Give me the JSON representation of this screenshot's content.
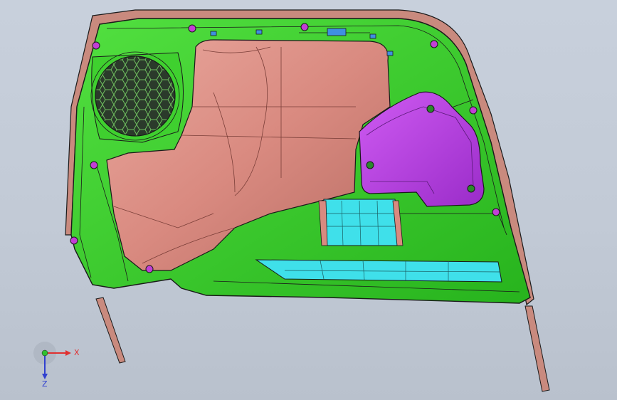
{
  "viewport": {
    "background_top": "#c8d0dc",
    "background_bottom": "#b9c1cd"
  },
  "colors": {
    "trim_border": "#c98a7e",
    "carrier_panel": "#35d12a",
    "upholstery_insert": "#d98a80",
    "pull_handle_cover": "#b33fe0",
    "map_pocket": "#3fe0ea",
    "speaker_grille": "#2b3a2b",
    "clip_mount": "#c23fd6",
    "outline": "#1a1a1a"
  },
  "model": {
    "components": [
      {
        "id": "trim-border",
        "icon": "outer-trim-strip-icon"
      },
      {
        "id": "carrier-panel",
        "icon": "door-carrier-icon"
      },
      {
        "id": "speaker-grille",
        "icon": "speaker-grille-icon"
      },
      {
        "id": "upholstery-insert",
        "icon": "armrest-insert-icon"
      },
      {
        "id": "pull-handle-cover",
        "icon": "handle-cover-icon"
      },
      {
        "id": "map-pocket",
        "icon": "map-pocket-icon"
      },
      {
        "id": "clip-mount",
        "icon": "clip-mount-icon"
      }
    ]
  },
  "triad": {
    "x_label": "X",
    "z_label": "Z",
    "x_color": "#e03030",
    "y_color": "#30c030",
    "z_color": "#3040d0"
  }
}
